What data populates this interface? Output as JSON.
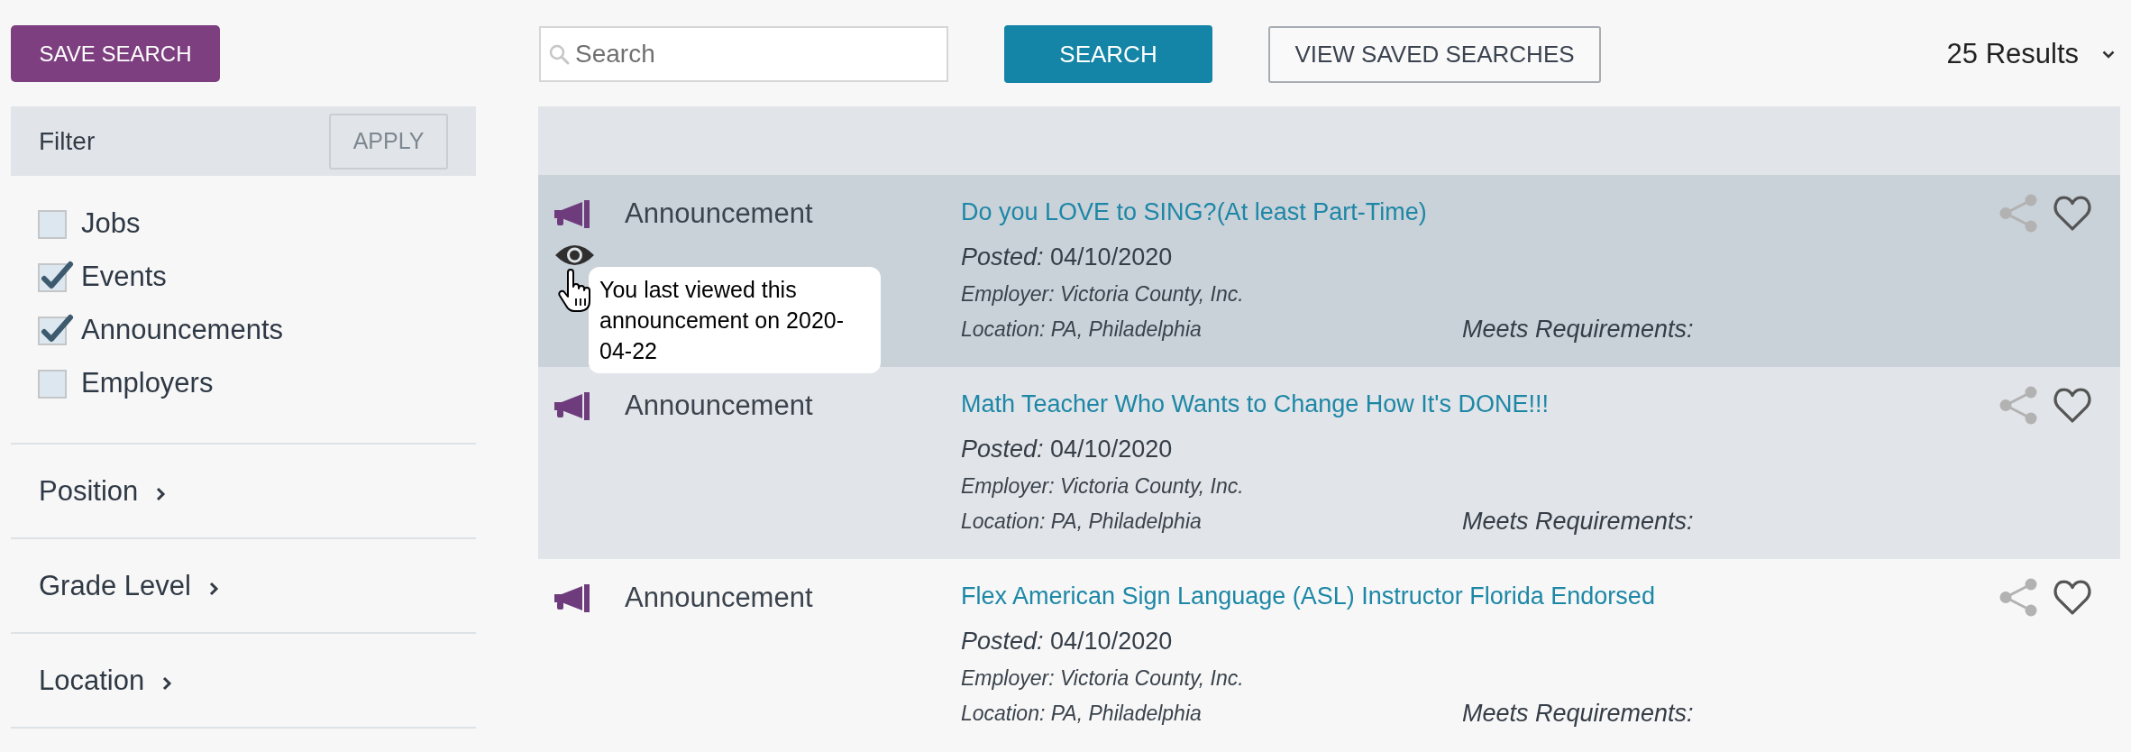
{
  "toolbar": {
    "save_search_button": "SAVE SEARCH",
    "search": {
      "placeholder": "Search"
    },
    "search_button": "SEARCH",
    "saved_searches_button": "VIEW SAVED SEARCHES",
    "results_count": "25 Results"
  },
  "filter": {
    "title": "Filter",
    "apply_button": "APPLY",
    "types": [
      {
        "label": "Jobs",
        "checked": false
      },
      {
        "label": "Events",
        "checked": true
      },
      {
        "label": "Announcements",
        "checked": true
      },
      {
        "label": "Employers",
        "checked": false
      }
    ],
    "sections": [
      {
        "label": "Position",
        "expanded": false
      },
      {
        "label": "Grade Level",
        "expanded": false
      },
      {
        "label": "Location",
        "expanded": false
      }
    ]
  },
  "results": [
    {
      "type": "Announcement",
      "title": "Do you LOVE to SING?(At least Part-Time)",
      "posted": "*Posted:* 04/10/2020",
      "employer": "Employer: Victoria County, Inc.",
      "location": "Location: PA, Philadelphia",
      "requirements": "Meets Requirements:",
      "viewed": true,
      "hovered": true,
      "tooltip": "You last viewed this announcement on 2020-04-22"
    },
    {
      "type": "Announcement",
      "title": "Math Teacher Who Wants to Change How It's DONE!!!",
      "posted": "*Posted:* 04/10/2020",
      "employer": "Employer: Victoria County, Inc.",
      "location": "Location: PA, Philadelphia",
      "requirements": "Meets Requirements:",
      "viewed": false,
      "hovered": false
    },
    {
      "type": "Announcement",
      "title": "Flex American Sign Language (ASL) Instructor Florida Endorsed",
      "posted": "*Posted:* 04/10/2020",
      "employer": "Employer: Victoria County, Inc.",
      "location": "Location: PA, Philadelphia",
      "requirements": "Meets Requirements:",
      "viewed": false,
      "hovered": false
    }
  ]
}
